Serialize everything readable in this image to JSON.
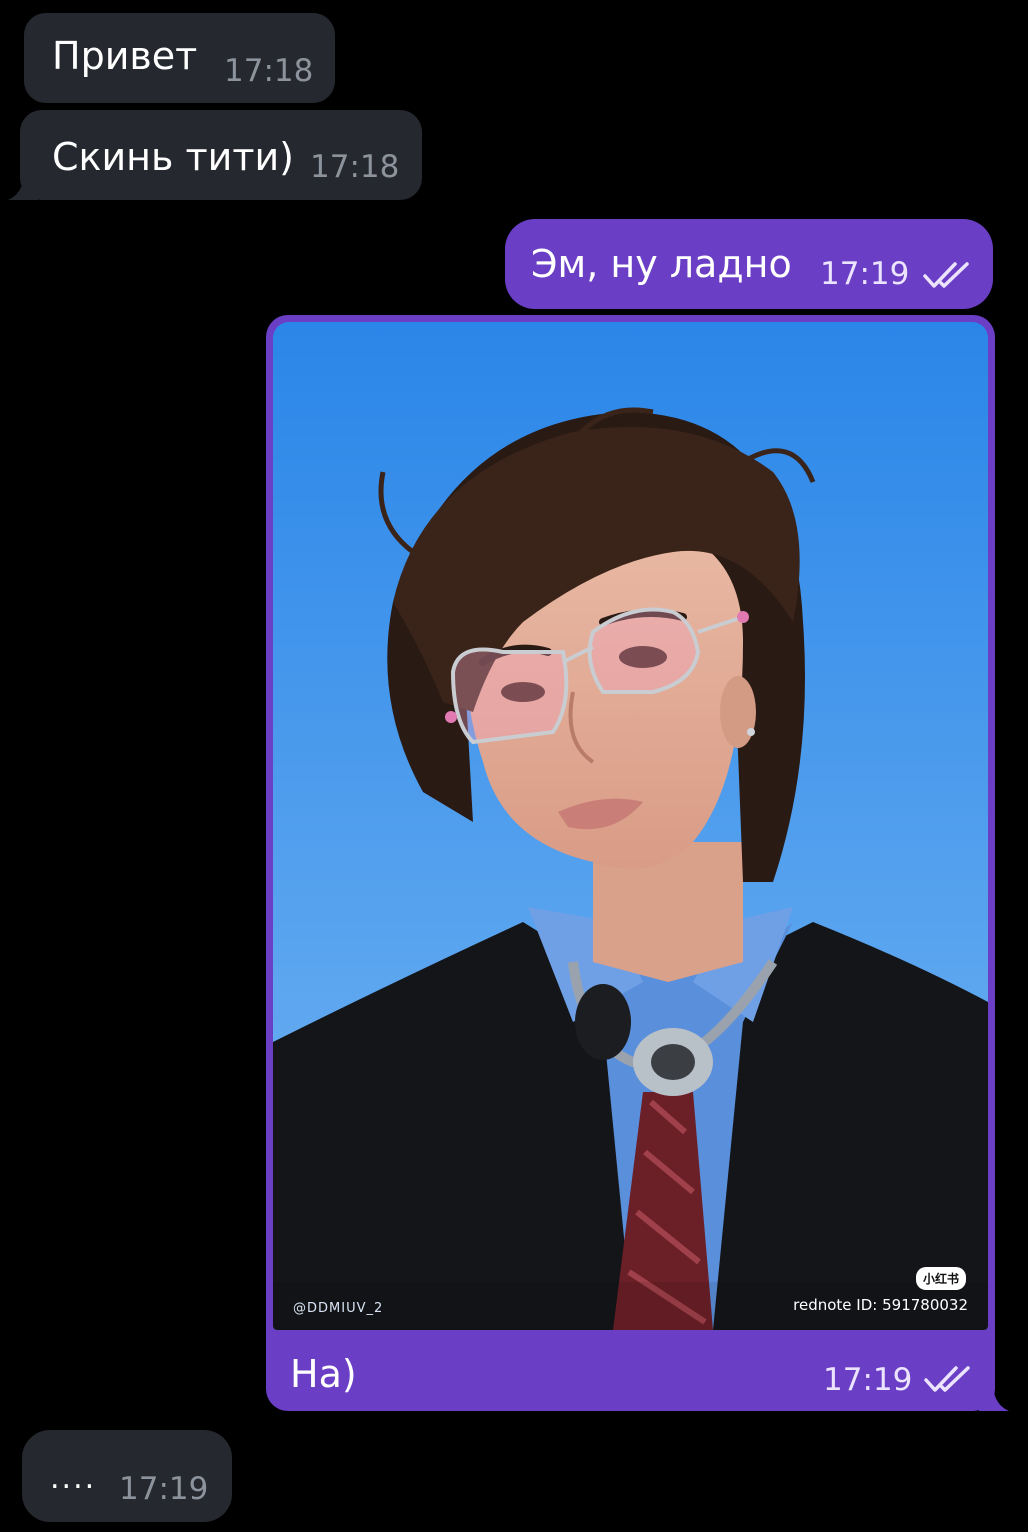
{
  "messages": [
    {
      "direction": "incoming",
      "text": "Привет",
      "time": "17:18"
    },
    {
      "direction": "incoming",
      "text": "Скинь тити)",
      "time": "17:18"
    },
    {
      "direction": "outgoing",
      "text": "Эм, ну ладно",
      "time": "17:19",
      "status": "read"
    },
    {
      "direction": "outgoing",
      "type": "photo",
      "caption": "На)",
      "time": "17:19",
      "status": "read",
      "image": {
        "watermark_left": "@DDMIUV_2",
        "watermark_badge": "小红书",
        "watermark_right": "rednote ID: 591780032"
      }
    },
    {
      "direction": "incoming",
      "text": "....",
      "time": "17:19"
    }
  ],
  "colors": {
    "background": "#000000",
    "incoming_bubble": "#25292f",
    "outgoing_bubble": "#6a3fc5",
    "incoming_time": "#8d939c",
    "photo_sky_top": "#2a86e8",
    "photo_sky_bottom": "#76b6f3"
  },
  "icons": [
    "double-check-icon"
  ]
}
